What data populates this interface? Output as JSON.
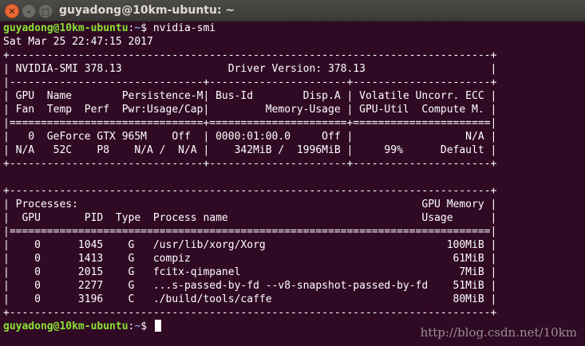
{
  "window": {
    "title": "guyadong@10km-ubuntu: ~",
    "close_glyph": "✕",
    "minimize_glyph": "–",
    "maximize_glyph": "□"
  },
  "prompt": {
    "user_host": "guyadong@10km-ubuntu",
    "colon": ":",
    "path": "~",
    "symbol": "$ "
  },
  "command": "nvidia-smi",
  "output_lines": [
    "Sat Mar 25 22:47:15 2017",
    "+-----------------------------------------------------------------------------+",
    "| NVIDIA-SMI 378.13                 Driver Version: 378.13                    |",
    "|-------------------------------+----------------------+----------------------+",
    "| GPU  Name        Persistence-M| Bus-Id        Disp.A | Volatile Uncorr. ECC |",
    "| Fan  Temp  Perf  Pwr:Usage/Cap|         Memory-Usage | GPU-Util  Compute M. |",
    "|===============================+======================+======================|",
    "|   0  GeForce GTX 965M    Off  | 0000:01:00.0     Off |                  N/A |",
    "| N/A   52C    P8    N/A /  N/A |    342MiB /  1996MiB |     99%      Default |",
    "+-------------------------------+----------------------+----------------------+",
    "",
    "+-----------------------------------------------------------------------------+",
    "| Processes:                                                       GPU Memory |",
    "|  GPU       PID  Type  Process name                               Usage      |",
    "|=============================================================================|",
    "|    0      1045    G   /usr/lib/xorg/Xorg                             100MiB |",
    "|    0      1413    G   compiz                                          61MiB |",
    "|    0      2015    G   fcitx-qimpanel                                   7MiB |",
    "|    0      2277    G   ...s-passed-by-fd --v8-snapshot-passed-by-fd    51MiB |",
    "|    0      3196    C   ./build/tools/caffe                             80MiB |",
    "+-----------------------------------------------------------------------------+"
  ],
  "watermark": "http://blog.csdn.net/10km",
  "colors": {
    "background": "#300a24",
    "text": "#ffffff",
    "prompt_user": "#8ae234",
    "prompt_path": "#729fcf",
    "close_button": "#e96a36"
  }
}
